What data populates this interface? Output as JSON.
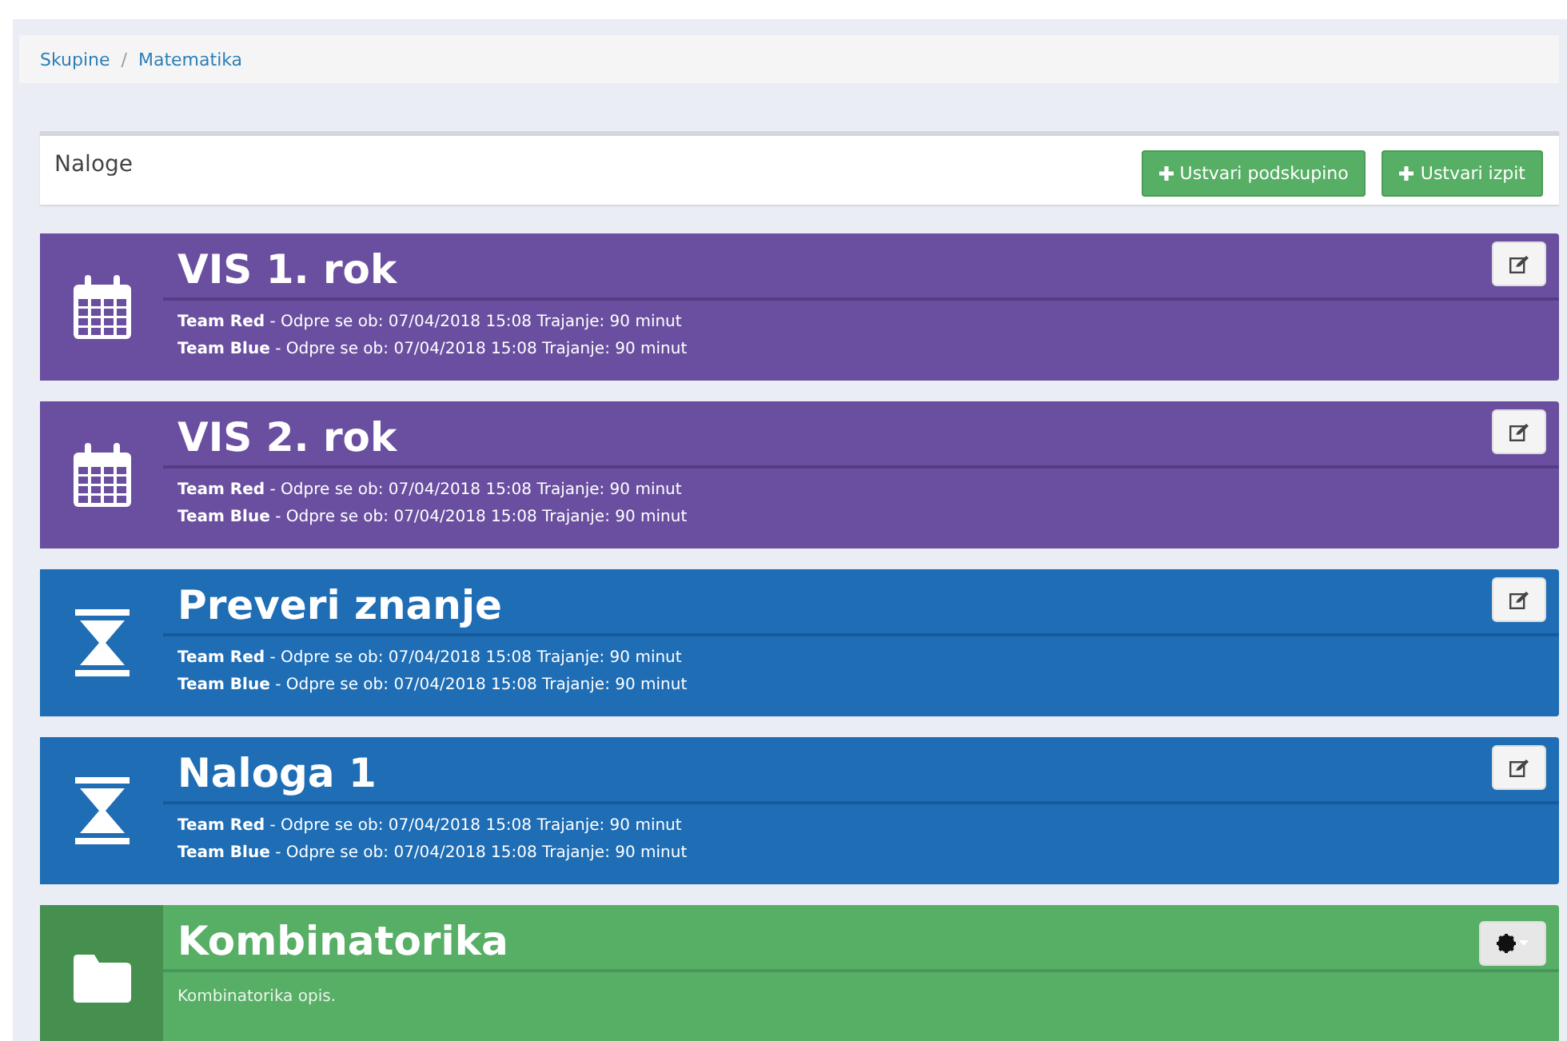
{
  "breadcrumb": [
    {
      "kind": "link",
      "text": "Skupine"
    },
    {
      "kind": "separator",
      "text": "/"
    },
    {
      "kind": "link",
      "text": "Matematika"
    }
  ],
  "panel": {
    "title": "Naloge",
    "buttons": [
      {
        "label": "Ustvari podskupino"
      },
      {
        "label": "Ustvari izpit"
      }
    ]
  },
  "cards": [
    {
      "kind": "exam",
      "title": "VIS 1. rok",
      "button": {
        "kind": "edit"
      },
      "lines": [
        "**Team Red** - Odpre se ob: 07/04/2018 15:08 Trajanje: 90 minut",
        "**Team Blue** - Odpre se ob: 07/04/2018 15:08 Trajanje: 90 minut"
      ]
    },
    {
      "kind": "exam",
      "title": "VIS 2. rok",
      "button": {
        "kind": "edit"
      },
      "lines": [
        "**Team Red** - Odpre se ob: 07/04/2018 15:08 Trajanje: 90 minut",
        "**Team Blue** - Odpre se ob: 07/04/2018 15:08 Trajanje: 90 minut"
      ]
    },
    {
      "kind": "quiz",
      "title": "Preveri znanje",
      "button": {
        "kind": "edit"
      },
      "lines": [
        "**Team Red** - Odpre se ob: 07/04/2018 15:08 Trajanje: 90 minut",
        "**Team Blue** - Odpre se ob: 07/04/2018 15:08 Trajanje: 90 minut"
      ]
    },
    {
      "kind": "quiz",
      "title": "Naloga 1",
      "button": {
        "kind": "edit"
      },
      "lines": [
        "**Team Red** - Odpre se ob: 07/04/2018 15:08 Trajanje: 90 minut",
        "**Team Blue** - Odpre se ob: 07/04/2018 15:08 Trajanje: 90 minut"
      ]
    },
    {
      "kind": "folder",
      "title": "Kombinatorika",
      "button": {
        "kind": "settings"
      },
      "lines": [
        "Kombinatorika opis."
      ]
    }
  ]
}
